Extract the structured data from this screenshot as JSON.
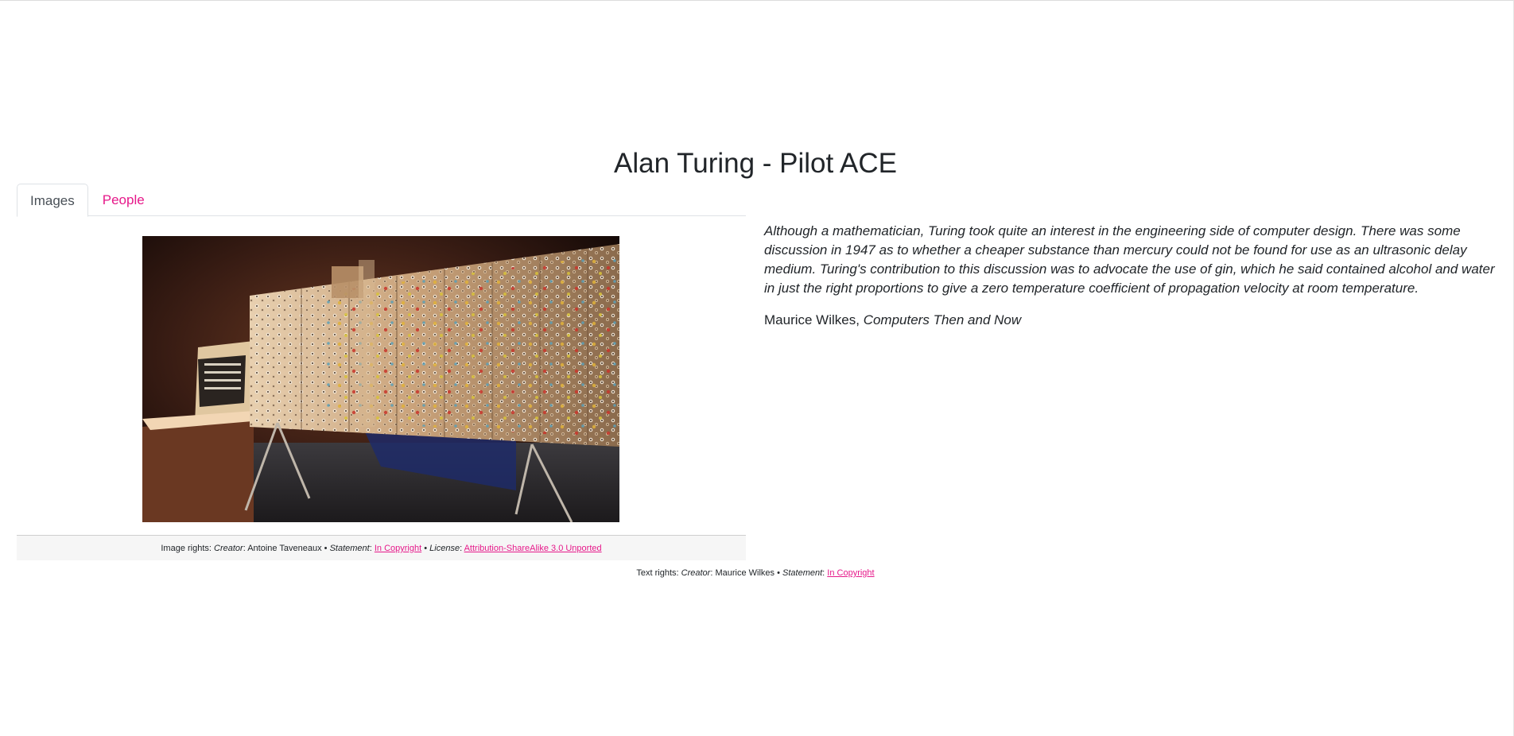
{
  "page": {
    "title": "Alan Turing - Pilot ACE"
  },
  "tabs": [
    {
      "label": "Images",
      "active": true
    },
    {
      "label": "People",
      "active": false
    }
  ],
  "image": {
    "subject": "Pilot ACE computer photograph"
  },
  "image_rights": {
    "prefix": "Image rights:",
    "creator_label": "Creator",
    "creator": "Antoine Taveneaux",
    "statement_label": "Statement",
    "statement": "In Copyright",
    "license_label": "License",
    "license": "Attribution-ShareAlike 3.0 Unported",
    "separator": "•"
  },
  "quote": {
    "text": "Although a mathematician, Turing took quite an interest in the engineering side of computer design. There was some discussion in 1947 as to whether a cheaper substance than mercury could not be found for use as an ultrasonic delay medium. Turing's contribution to this discussion was to advocate the use of gin, which he said contained alcohol and water in just the right proportions to give a zero temperature coefficient of propagation velocity at room temperature.",
    "author": "Maurice Wilkes,",
    "source": "Computers Then and Now"
  },
  "text_rights": {
    "prefix": "Text rights:",
    "creator_label": "Creator",
    "creator": "Maurice Wilkes",
    "statement_label": "Statement",
    "statement": "In Copyright",
    "separator": "•"
  },
  "colors": {
    "accent": "#e6198a",
    "text": "#212529",
    "rights_background": "#f6f6f6"
  }
}
